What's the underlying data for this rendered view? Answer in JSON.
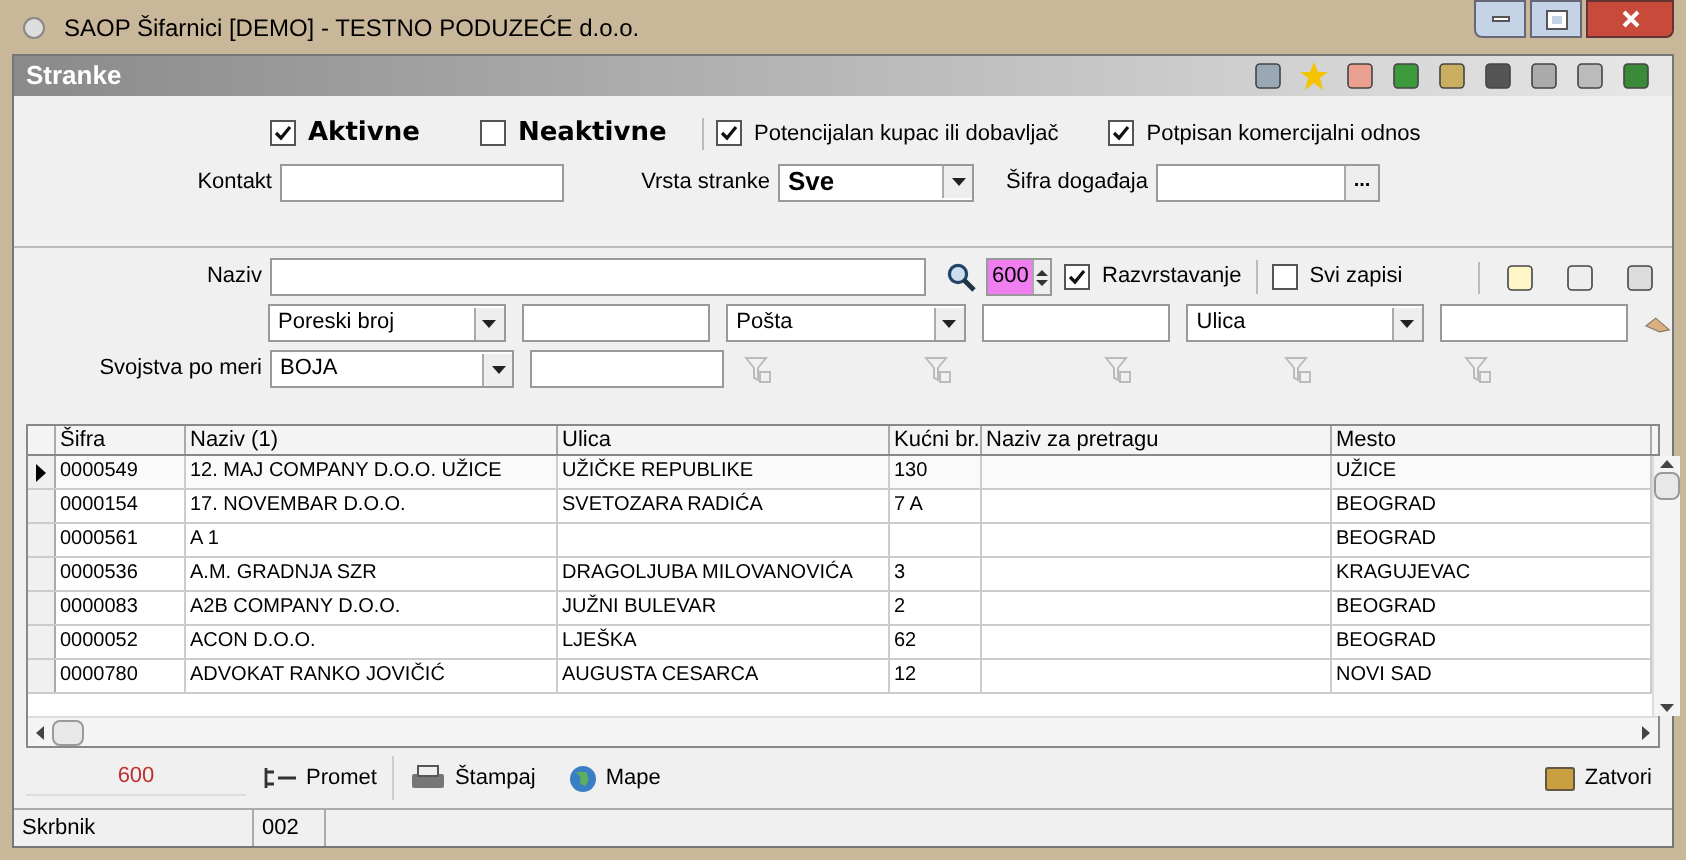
{
  "window": {
    "title": "SAOP Šifarnici [DEMO] - TESTNO PODUZEĆE d.o.o."
  },
  "panel": {
    "title": "Stranke"
  },
  "status_filters": [
    {
      "label": "Aktivne",
      "checked": true
    },
    {
      "label": "Neaktivne",
      "checked": false
    }
  ],
  "relation_filters": [
    {
      "label": "Potencijalan kupac ili dobavljač",
      "checked": true
    },
    {
      "label": "Potpisan komercijalni odnos",
      "checked": true
    }
  ],
  "contact_field": {
    "label": "Kontakt"
  },
  "type_field": {
    "label": "Vrsta stranke",
    "value": "Sve"
  },
  "event_field": {
    "label": "Šifra događaja",
    "button": "..."
  },
  "search": {
    "label": "Naziv",
    "limit": "600",
    "sort": {
      "label": "Razvrstavanje",
      "checked": true
    },
    "all_records": {
      "label": "Svi zapisi",
      "checked": false
    }
  },
  "filter_selects": [
    "Poreski broj",
    "Pošta",
    "Ulica"
  ],
  "custom_props": {
    "label": "Svojstva po meri",
    "value": "BOJA"
  },
  "table": {
    "columns": [
      "Šifra",
      "Naziv (1)",
      "Ulica",
      "Kućni br.",
      "Naziv za pretragu",
      "Mesto"
    ],
    "rows": [
      {
        "cells": [
          "0000549",
          "12. MAJ COMPANY D.O.O. UŽICE",
          "UŽIČKE REPUBLIKE",
          "130",
          "",
          "UŽICE"
        ],
        "selected": true
      },
      {
        "cells": [
          "0000154",
          "17. NOVEMBAR D.O.O.",
          "SVETOZARA RADIĆA",
          "7 A",
          "",
          "BEOGRAD"
        ],
        "selected": false
      },
      {
        "cells": [
          "0000561",
          "A 1",
          "",
          "",
          "",
          "BEOGRAD"
        ],
        "selected": false
      },
      {
        "cells": [
          "0000536",
          "A.M. GRADNJA SZR",
          "DRAGOLJUBA MILOVANOVIĆA",
          "3",
          "",
          "KRAGUJEVAC"
        ],
        "selected": false
      },
      {
        "cells": [
          "0000083",
          "A2B COMPANY  D.O.O.",
          "JUŽNI BULEVAR",
          "2",
          "",
          "BEOGRAD"
        ],
        "selected": false
      },
      {
        "cells": [
          "0000052",
          "ACON D.O.O.",
          "LJEŠKA",
          "62",
          "",
          "BEOGRAD"
        ],
        "selected": false
      },
      {
        "cells": [
          "0000780",
          "ADVOKAT RANKO JOVIČIĆ",
          "AUGUSTA CESARCA",
          "12",
          "",
          "NOVI SAD"
        ],
        "selected": false
      }
    ]
  },
  "footer": {
    "count": "600",
    "buttons": [
      {
        "label": "Promet",
        "kind": "turnover"
      },
      {
        "label": "Štampaj",
        "kind": "print"
      },
      {
        "label": "Mape",
        "kind": "map"
      }
    ],
    "close": "Zatvori"
  },
  "status_bar": [
    "Skrbnik",
    "002"
  ]
}
